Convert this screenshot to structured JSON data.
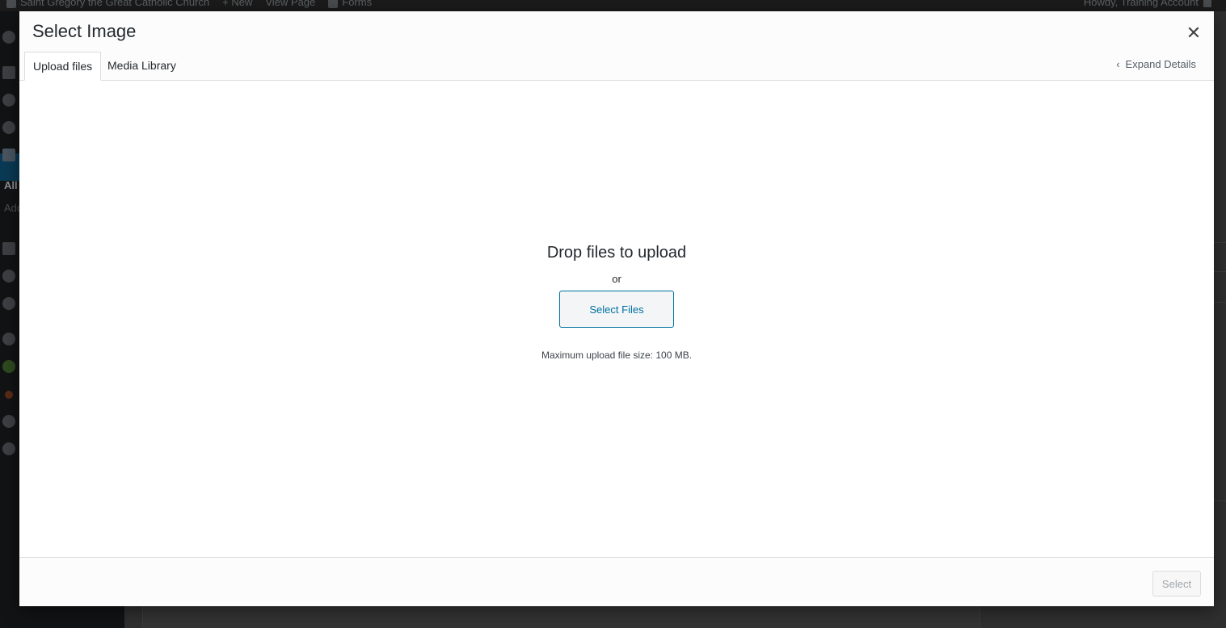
{
  "adminbar": {
    "site_name": "Saint Gregory the Great Catholic Church",
    "new_label": "New",
    "view_page_label": "View Page",
    "forms_label": "Forms",
    "greeting": "Howdy, Training Account"
  },
  "sidebar": {
    "sub_all": "All",
    "sub_add": "Add"
  },
  "modal": {
    "title": "Select Image",
    "close_icon": "close-icon",
    "tabs": [
      {
        "label": "Upload files",
        "active": true
      },
      {
        "label": "Media Library",
        "active": false
      }
    ],
    "expand_details": "Expand Details",
    "upload": {
      "drop_title": "Drop files to upload",
      "or_text": "or",
      "select_files_label": "Select Files",
      "max_size": "Maximum upload file size: 100 MB."
    },
    "footer": {
      "select_label": "Select"
    }
  },
  "colors": {
    "accent": "#0071a1",
    "modal_bg": "#ffffff",
    "overlay": "#1c1c1c"
  }
}
